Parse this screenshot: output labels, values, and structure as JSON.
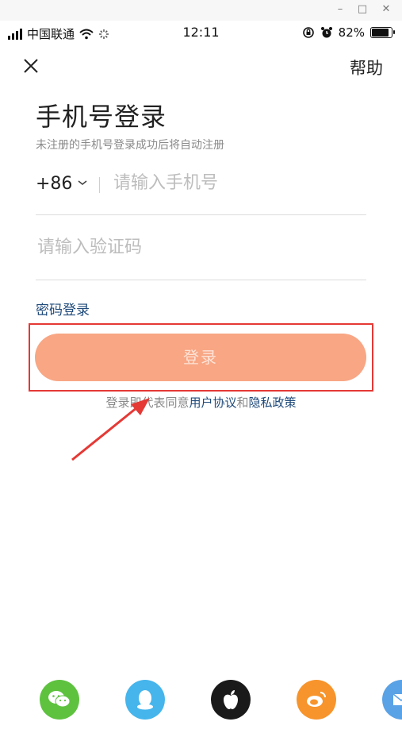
{
  "status_bar": {
    "carrier": "中国联通",
    "time": "12:11",
    "battery": "82%"
  },
  "nav": {
    "help_label": "帮助"
  },
  "login": {
    "title": "手机号登录",
    "subtitle": "未注册的手机号登录成功后将自动注册",
    "country_code": "+86",
    "phone_placeholder": "请输入手机号",
    "code_placeholder": "请输入验证码",
    "password_login_label": "密码登录",
    "login_button_label": "登录",
    "agreement_prefix": "登录即代表同意",
    "user_agreement_label": "用户协议",
    "agreement_and": "和",
    "privacy_policy_label": "隐私政策"
  },
  "social_logins": [
    {
      "name": "wechat",
      "color": "#5ec23f"
    },
    {
      "name": "qq",
      "color": "#45b5ec"
    },
    {
      "name": "apple",
      "color": "#1a1a1a"
    },
    {
      "name": "weibo",
      "color": "#f7942b"
    },
    {
      "name": "email",
      "color": "#5aa2e6"
    }
  ],
  "colors": {
    "accent": "#f8a684",
    "link": "#1f4a7a",
    "highlight": "#e53935"
  }
}
